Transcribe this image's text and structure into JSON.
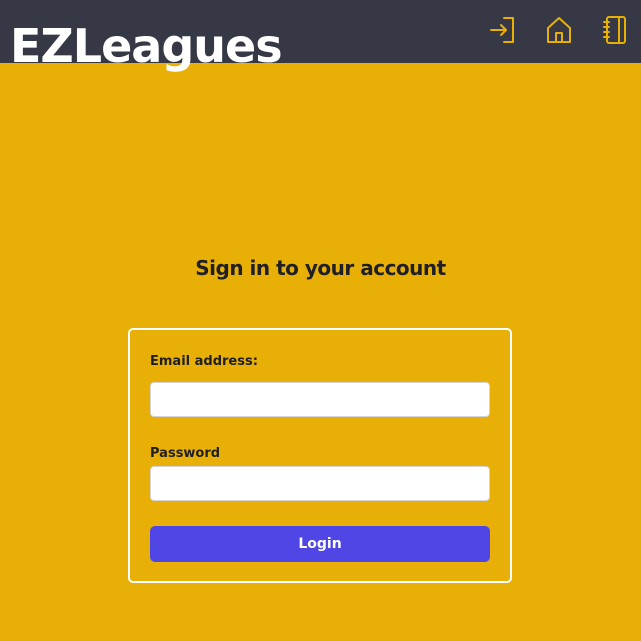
{
  "header": {
    "brand": "EZLeagues",
    "nav": [
      {
        "icon": "login-icon"
      },
      {
        "icon": "home-icon"
      },
      {
        "icon": "notebook-icon"
      }
    ]
  },
  "main": {
    "title": "Sign in to your account",
    "form": {
      "email_label": "Email address:",
      "email_value": "",
      "password_label": "Password",
      "password_value": "",
      "login_label": "Login"
    }
  },
  "colors": {
    "header_bg": "#363945",
    "page_bg": "#e8b006",
    "accent_icon": "#e8b006",
    "button_bg": "#4f46e5",
    "text_dark": "#1f1f24"
  }
}
